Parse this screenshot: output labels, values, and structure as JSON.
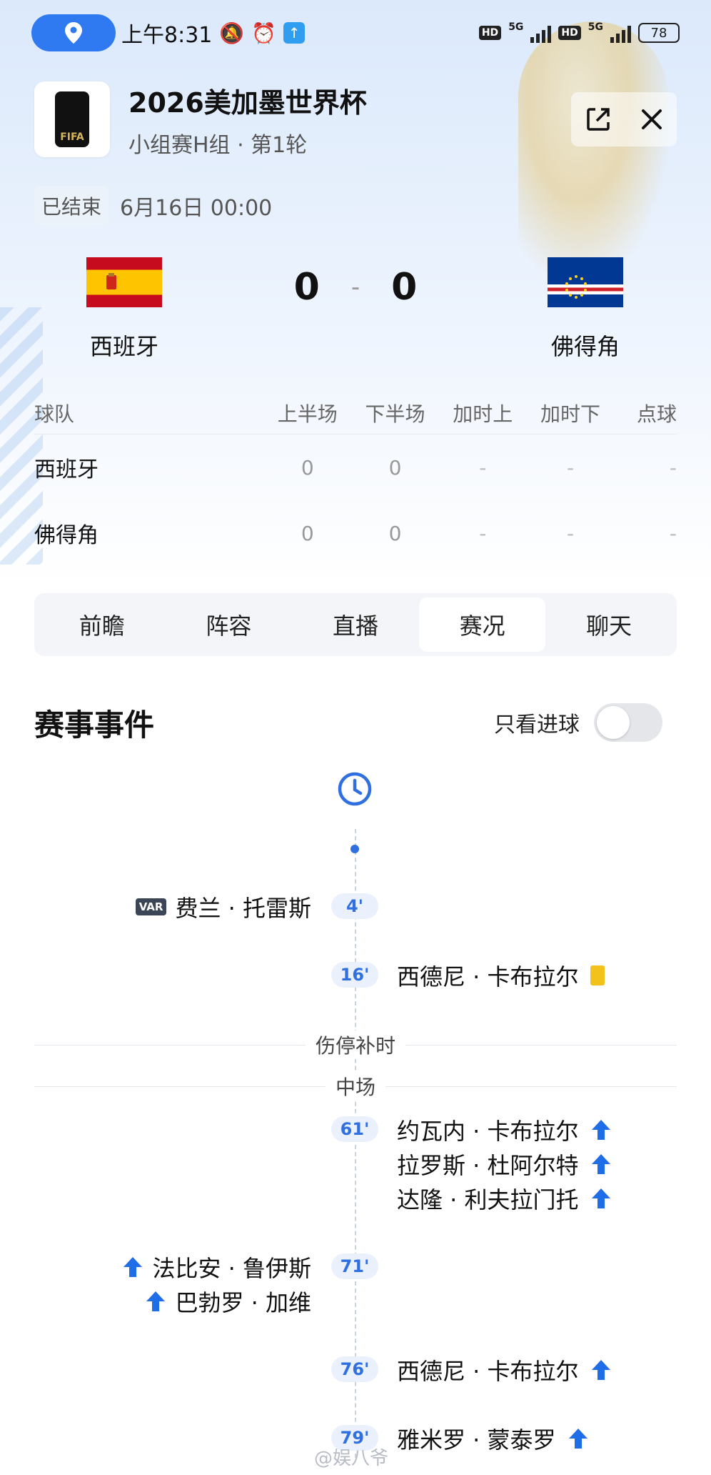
{
  "status_bar": {
    "time": "上午8:31",
    "network_1": "5G",
    "network_2": "5G",
    "hd_label": "HD",
    "battery": "78"
  },
  "header": {
    "title": "2026美加墨世界杯",
    "subtitle": "小组赛H组 · 第1轮",
    "logo_text": "FIFA"
  },
  "match": {
    "status": "已结束",
    "datetime": "6月16日 00:00",
    "home": {
      "name": "西班牙",
      "score": "0"
    },
    "away": {
      "name": "佛得角",
      "score": "0"
    },
    "dash": "-"
  },
  "score_table": {
    "headers": [
      "球队",
      "上半场",
      "下半场",
      "加时上",
      "加时下",
      "点球"
    ],
    "rows": [
      {
        "team": "西班牙",
        "h1": "0",
        "h2": "0",
        "et1": "-",
        "et2": "-",
        "pk": "-"
      },
      {
        "team": "佛得角",
        "h1": "0",
        "h2": "0",
        "et1": "-",
        "et2": "-",
        "pk": "-"
      }
    ]
  },
  "tabs": [
    "前瞻",
    "阵容",
    "直播",
    "赛况",
    "聊天"
  ],
  "active_tab": "赛况",
  "events": {
    "title": "赛事事件",
    "filter_label": "只看进球",
    "filter_on": false,
    "var_label": "VAR",
    "items": [
      {
        "minute": "4'",
        "player": "费兰 · 托雷斯"
      },
      {
        "minute": "16'",
        "player": "西德尼 · 卡布拉尔"
      },
      {
        "divider": "伤停补时"
      },
      {
        "divider": "中场"
      },
      {
        "minute": "61'",
        "players": [
          "约瓦内 · 卡布拉尔",
          "拉罗斯 · 杜阿尔特",
          "达隆 · 利夫拉门托"
        ]
      },
      {
        "minute": "71'",
        "players": [
          "法比安 · 鲁伊斯",
          "巴勃罗 · 加维"
        ]
      },
      {
        "minute": "76'",
        "player": "西德尼 · 卡布拉尔"
      },
      {
        "minute": "79'",
        "player": "雅米罗 · 蒙泰罗"
      }
    ]
  },
  "watermark": "@娱八爷",
  "colors": {
    "accent": "#2f6fe0",
    "yellow_card": "#f2c21b",
    "location_pill": "#2f7af0"
  },
  "icons": [
    "location-icon",
    "alarm-off-icon",
    "alarm-icon",
    "upload-icon",
    "signal-icon",
    "battery-icon",
    "edit-icon",
    "close-icon",
    "clock-icon",
    "var-icon",
    "yellow-card-icon",
    "substitution-up-icon",
    "toggle-icon"
  ]
}
